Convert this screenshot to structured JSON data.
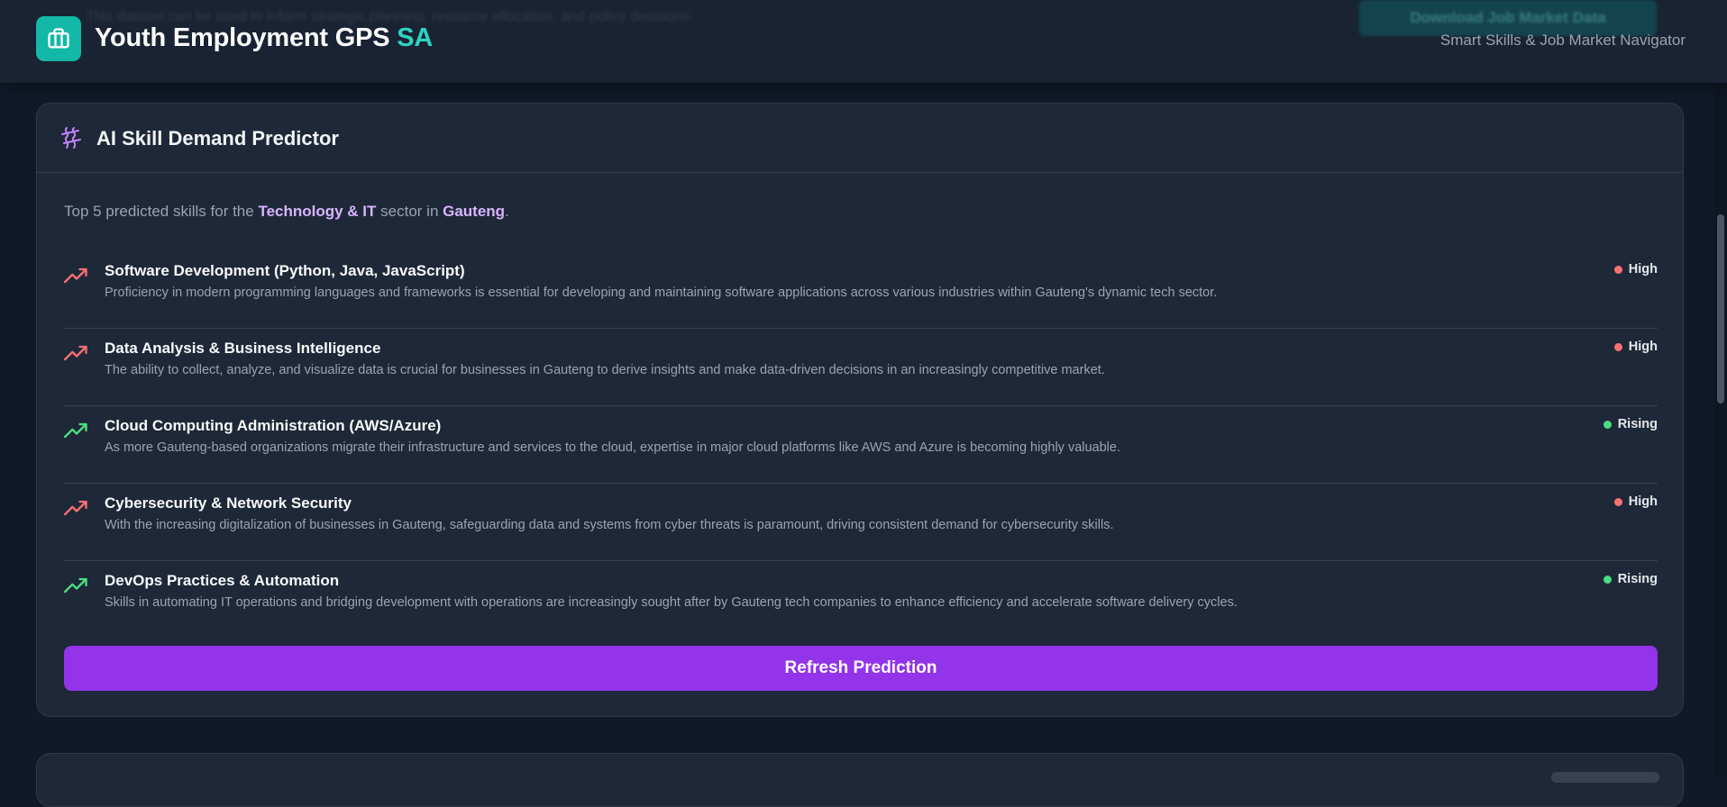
{
  "header": {
    "title_main": "Youth Employment GPS",
    "title_accent": "SA",
    "subtitle": "Smart Skills & Job Market Navigator",
    "logo_icon": "briefcase-icon",
    "behind_text": "This dataset can be used to inform strategic planning, resource allocation, and policy decisions.",
    "behind_button": "Download Job Market Data"
  },
  "card": {
    "title": "AI Skill Demand Predictor",
    "icon": "sparkle-waves-icon",
    "intro": {
      "prefix": "Top 5 predicted skills for the ",
      "sector": "Technology & IT",
      "middle": " sector in ",
      "region": "Gauteng",
      "suffix": "."
    },
    "skills": [
      {
        "name": "Software Development (Python, Java, JavaScript)",
        "description": "Proficiency in modern programming languages and frameworks is essential for developing and maintaining software applications across various industries within Gauteng's dynamic tech sector.",
        "level": "High"
      },
      {
        "name": "Data Analysis & Business Intelligence",
        "description": "The ability to collect, analyze, and visualize data is crucial for businesses in Gauteng to derive insights and make data-driven decisions in an increasingly competitive market.",
        "level": "High"
      },
      {
        "name": "Cloud Computing Administration (AWS/Azure)",
        "description": "As more Gauteng-based organizations migrate their infrastructure and services to the cloud, expertise in major cloud platforms like AWS and Azure is becoming highly valuable.",
        "level": "Rising"
      },
      {
        "name": "Cybersecurity & Network Security",
        "description": "With the increasing digitalization of businesses in Gauteng, safeguarding data and systems from cyber threats is paramount, driving consistent demand for cybersecurity skills.",
        "level": "High"
      },
      {
        "name": "DevOps Practices & Automation",
        "description": "Skills in automating IT operations and bridging development with operations are increasingly sought after by Gauteng tech companies to enhance efficiency and accelerate software delivery cycles.",
        "level": "Rising"
      }
    ],
    "refresh_label": "Refresh Prediction"
  },
  "colors": {
    "teal": "#14b8a6",
    "teal_text": "#2dd4bf",
    "purple": "#9333ea",
    "purple_highlight": "#d8b4fe",
    "high": "#f87171",
    "rising": "#4ade80"
  }
}
